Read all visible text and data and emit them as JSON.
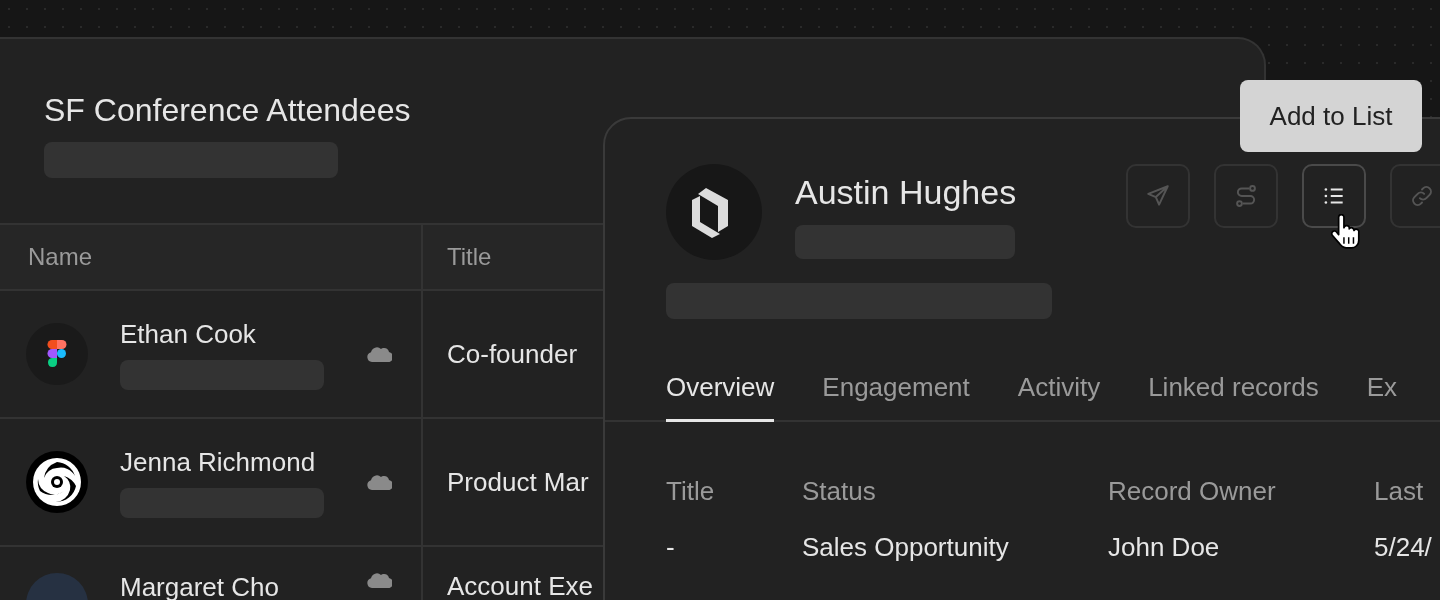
{
  "list": {
    "title": "SF Conference Attendees"
  },
  "table": {
    "columns": [
      "Name",
      "Title"
    ],
    "rows": [
      {
        "name": "Ethan Cook",
        "title": "Co-founder",
        "kind": "blocks"
      },
      {
        "name": "Jenna Richmond",
        "title": "Product Mar",
        "kind": "swirl"
      },
      {
        "name": "Margaret Cho",
        "title": "Account Exe",
        "kind": "dark"
      }
    ]
  },
  "record": {
    "name": "Austin Hughes",
    "actions": [
      {
        "kind": "send",
        "selected": false
      },
      {
        "kind": "route",
        "selected": false
      },
      {
        "kind": "list",
        "selected": true
      },
      {
        "kind": "link",
        "selected": false
      }
    ],
    "tooltip": "Add to List",
    "tabs": [
      {
        "label": "Overview",
        "selected": true
      },
      {
        "label": "Engagement",
        "selected": false
      },
      {
        "label": "Activity",
        "selected": false
      },
      {
        "label": "Linked records",
        "selected": false
      },
      {
        "label": "Ex",
        "selected": false
      }
    ],
    "fields": [
      {
        "label": "Title",
        "value": "-"
      },
      {
        "label": "Status",
        "value": "Sales Opportunity"
      },
      {
        "label": "Record Owner",
        "value": "John Doe"
      },
      {
        "label": "Last",
        "value": "5/24/"
      }
    ]
  }
}
